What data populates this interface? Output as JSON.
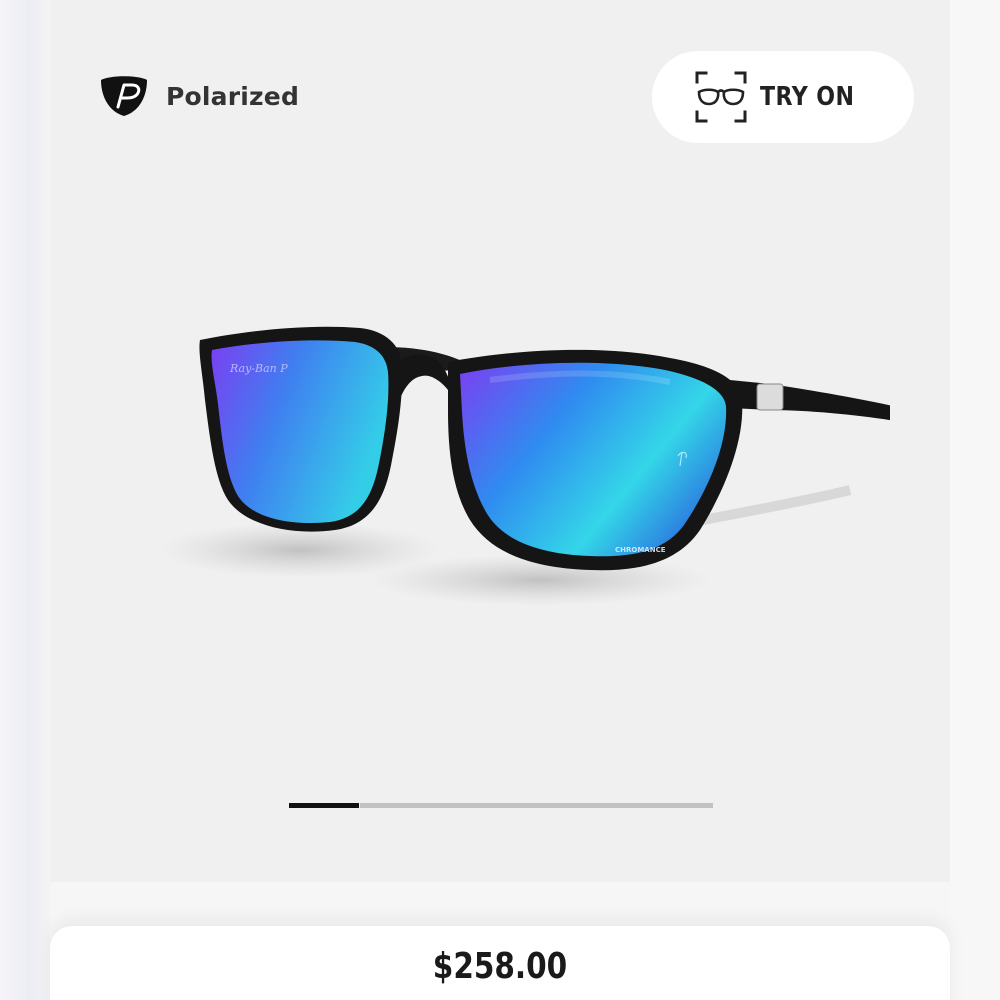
{
  "badge": {
    "icon": "polarized-p-icon",
    "label": "Polarized"
  },
  "try_on": {
    "icon": "glasses-scan-icon",
    "label": "TRY ON"
  },
  "product": {
    "image": "sunglasses-product-image",
    "lens_marks": {
      "logo": "Ray-Ban P",
      "lens_label": "CHROMANCE"
    }
  },
  "carousel": {
    "total": 6,
    "active_index": 0
  },
  "price": "$258.00",
  "colors": {
    "lens_purple": "#7b3ff2",
    "lens_blue": "#2fa8f2",
    "lens_cyan": "#34d6e8",
    "frame": "#141414",
    "indicator_active": "#111111",
    "indicator_inactive": "#c2c2c2"
  }
}
